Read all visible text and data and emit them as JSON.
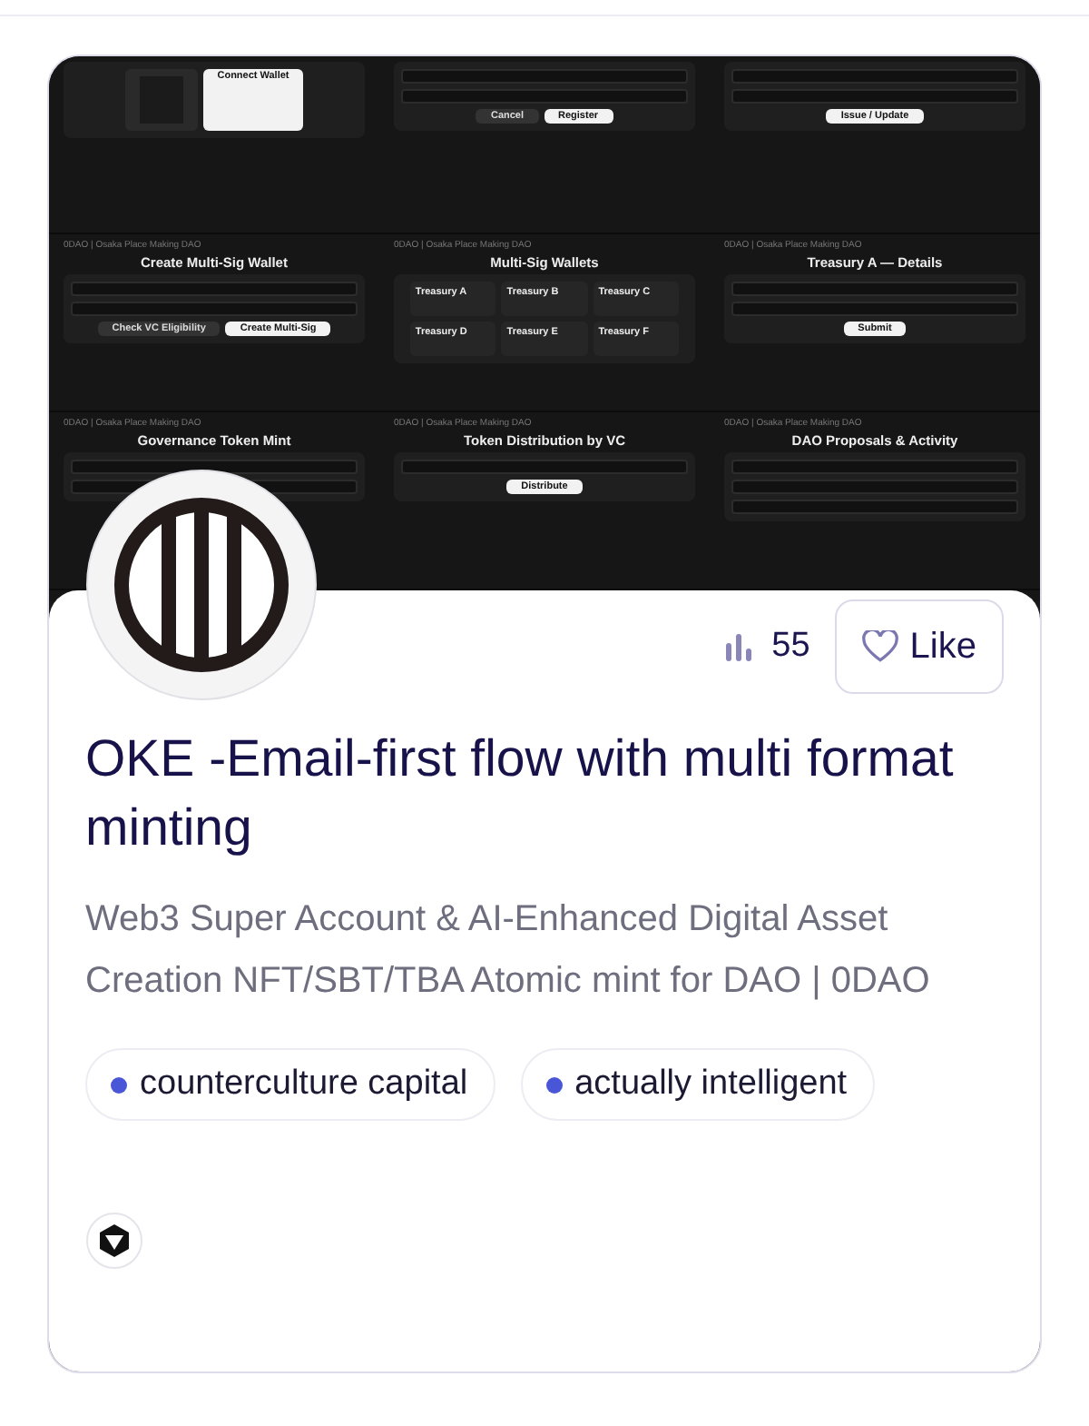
{
  "cover": {
    "panels": [
      {
        "items": [
          {
            "kind": "qr"
          },
          {
            "kind": "button",
            "label": "Connect Wallet"
          }
        ]
      },
      {
        "items": [
          {
            "kind": "field"
          },
          {
            "kind": "field"
          },
          {
            "kind": "dark-button",
            "label": "Cancel"
          },
          {
            "kind": "button",
            "label": "Register"
          }
        ]
      },
      {
        "items": [
          {
            "kind": "field"
          },
          {
            "kind": "field"
          },
          {
            "kind": "button",
            "label": "Issue / Update"
          }
        ]
      },
      {
        "header": "0DAO | Osaka Place Making DAO",
        "title": "Create Multi-Sig Wallet",
        "items": [
          {
            "kind": "field"
          },
          {
            "kind": "field"
          },
          {
            "kind": "dark-button",
            "label": "Check VC Eligibility"
          },
          {
            "kind": "button",
            "label": "Create Multi-Sig"
          }
        ]
      },
      {
        "header": "0DAO | Osaka Place Making DAO",
        "title": "Multi-Sig Wallets",
        "items": [
          {
            "kind": "card",
            "label": "Treasury A"
          },
          {
            "kind": "card",
            "label": "Treasury B"
          },
          {
            "kind": "card",
            "label": "Treasury C"
          },
          {
            "kind": "card",
            "label": "Treasury D"
          },
          {
            "kind": "card",
            "label": "Treasury E"
          },
          {
            "kind": "card",
            "label": "Treasury F"
          }
        ]
      },
      {
        "header": "0DAO | Osaka Place Making DAO",
        "title": "Treasury A — Details",
        "items": [
          {
            "kind": "field"
          },
          {
            "kind": "field"
          },
          {
            "kind": "button",
            "label": "Submit"
          }
        ]
      },
      {
        "header": "0DAO | Osaka Place Making DAO",
        "title": "Governance Token Mint",
        "items": [
          {
            "kind": "field"
          },
          {
            "kind": "field"
          }
        ]
      },
      {
        "header": "0DAO | Osaka Place Making DAO",
        "title": "Token Distribution by VC",
        "items": [
          {
            "kind": "field"
          },
          {
            "kind": "button",
            "label": "Distribute"
          }
        ]
      },
      {
        "header": "0DAO | Osaka Place Making DAO",
        "title": "DAO Proposals & Activity",
        "items": [
          {
            "kind": "field"
          },
          {
            "kind": "field"
          },
          {
            "kind": "field"
          }
        ]
      }
    ]
  },
  "stats": {
    "count": "55"
  },
  "like_button": {
    "label": "Like"
  },
  "title": "OKE -Email-first flow with multi format minting",
  "description": "Web3 Super Account & AI-Enhanced Digital Asset Creation NFT/SBT/TBA Atomic mint for DAO | 0DAO",
  "tags": [
    {
      "label": "counterculture capital",
      "color": "#4a56d8"
    },
    {
      "label": "actually intelligent",
      "color": "#4a56d8"
    }
  ]
}
